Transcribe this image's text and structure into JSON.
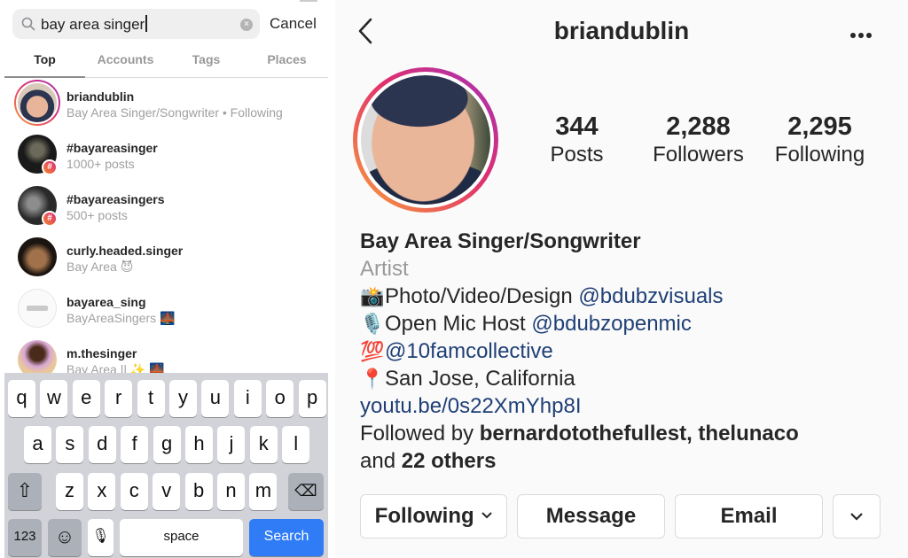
{
  "search": {
    "query": "bay area singer",
    "cancel_label": "Cancel",
    "tabs": [
      {
        "label": "Top",
        "active": true
      },
      {
        "label": "Accounts",
        "active": false
      },
      {
        "label": "Tags",
        "active": false
      },
      {
        "label": "Places",
        "active": false
      }
    ],
    "results": [
      {
        "name": "briandublin",
        "subtitle": "Bay Area Singer/Songwriter • Following",
        "type": "account",
        "story_ring": true
      },
      {
        "name": "#bayareasinger",
        "subtitle": "1000+ posts",
        "type": "hashtag"
      },
      {
        "name": "#bayareasingers",
        "subtitle": "500+ posts",
        "type": "hashtag"
      },
      {
        "name": "curly.headed.singer",
        "subtitle": "Bay Area 😈",
        "type": "account"
      },
      {
        "name": "bayarea_sing",
        "subtitle": "BayAreaSingers 🌉",
        "type": "account"
      },
      {
        "name": "m.thesinger",
        "subtitle": "Bay Area || ✨ 🌉",
        "type": "account"
      }
    ],
    "hash_badge": "#"
  },
  "keyboard": {
    "row1": [
      "q",
      "w",
      "e",
      "r",
      "t",
      "y",
      "u",
      "i",
      "o",
      "p"
    ],
    "row2": [
      "a",
      "s",
      "d",
      "f",
      "g",
      "h",
      "j",
      "k",
      "l"
    ],
    "row3": [
      "z",
      "x",
      "c",
      "v",
      "b",
      "n",
      "m"
    ],
    "shift_glyph": "⇧",
    "delete_glyph": "⌫",
    "numbers_label": "123",
    "emoji_glyph": "☺",
    "mic_glyph": "🎙",
    "space_label": "space",
    "search_label": "Search"
  },
  "profile": {
    "username": "briandublin",
    "stats": [
      {
        "value": "344",
        "label": "Posts"
      },
      {
        "value": "2,288",
        "label": "Followers"
      },
      {
        "value": "2,295",
        "label": "Following"
      }
    ],
    "display_name": "Bay Area Singer/Songwriter",
    "category": "Artist",
    "bio_lines": [
      {
        "emoji": "📸",
        "text": "Photo/Video/Design ",
        "link": "@bdubzvisuals"
      },
      {
        "emoji": "🎙️",
        "text": "Open Mic Host ",
        "link": "@bdubzopenmic"
      },
      {
        "emoji": "💯",
        "text": "",
        "link": "@10famcollective"
      },
      {
        "emoji": "📍",
        "text": "San Jose, California",
        "link": ""
      }
    ],
    "website": "youtu.be/0s22XmYhp8I",
    "followed_by_prefix": "Followed by ",
    "followed_by_names": "bernardotothefullest, thelunaco",
    "followed_by_and": "and ",
    "followed_by_others": "22 others",
    "buttons": {
      "following": "Following",
      "message": "Message",
      "email": "Email"
    },
    "colors": {
      "link": "#1f3f76",
      "muted": "#999999",
      "keyboard_search": "#2f7cf6"
    }
  }
}
